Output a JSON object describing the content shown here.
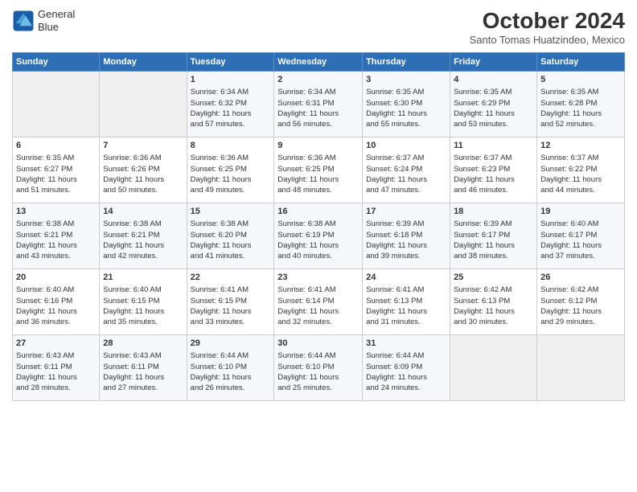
{
  "header": {
    "logo": {
      "line1": "General",
      "line2": "Blue"
    },
    "title": "October 2024",
    "subtitle": "Santo Tomas Huatzindeo, Mexico"
  },
  "days_of_week": [
    "Sunday",
    "Monday",
    "Tuesday",
    "Wednesday",
    "Thursday",
    "Friday",
    "Saturday"
  ],
  "weeks": [
    [
      {
        "day": "",
        "lines": []
      },
      {
        "day": "",
        "lines": []
      },
      {
        "day": "1",
        "lines": [
          "Sunrise: 6:34 AM",
          "Sunset: 6:32 PM",
          "Daylight: 11 hours",
          "and 57 minutes."
        ]
      },
      {
        "day": "2",
        "lines": [
          "Sunrise: 6:34 AM",
          "Sunset: 6:31 PM",
          "Daylight: 11 hours",
          "and 56 minutes."
        ]
      },
      {
        "day": "3",
        "lines": [
          "Sunrise: 6:35 AM",
          "Sunset: 6:30 PM",
          "Daylight: 11 hours",
          "and 55 minutes."
        ]
      },
      {
        "day": "4",
        "lines": [
          "Sunrise: 6:35 AM",
          "Sunset: 6:29 PM",
          "Daylight: 11 hours",
          "and 53 minutes."
        ]
      },
      {
        "day": "5",
        "lines": [
          "Sunrise: 6:35 AM",
          "Sunset: 6:28 PM",
          "Daylight: 11 hours",
          "and 52 minutes."
        ]
      }
    ],
    [
      {
        "day": "6",
        "lines": [
          "Sunrise: 6:35 AM",
          "Sunset: 6:27 PM",
          "Daylight: 11 hours",
          "and 51 minutes."
        ]
      },
      {
        "day": "7",
        "lines": [
          "Sunrise: 6:36 AM",
          "Sunset: 6:26 PM",
          "Daylight: 11 hours",
          "and 50 minutes."
        ]
      },
      {
        "day": "8",
        "lines": [
          "Sunrise: 6:36 AM",
          "Sunset: 6:25 PM",
          "Daylight: 11 hours",
          "and 49 minutes."
        ]
      },
      {
        "day": "9",
        "lines": [
          "Sunrise: 6:36 AM",
          "Sunset: 6:25 PM",
          "Daylight: 11 hours",
          "and 48 minutes."
        ]
      },
      {
        "day": "10",
        "lines": [
          "Sunrise: 6:37 AM",
          "Sunset: 6:24 PM",
          "Daylight: 11 hours",
          "and 47 minutes."
        ]
      },
      {
        "day": "11",
        "lines": [
          "Sunrise: 6:37 AM",
          "Sunset: 6:23 PM",
          "Daylight: 11 hours",
          "and 46 minutes."
        ]
      },
      {
        "day": "12",
        "lines": [
          "Sunrise: 6:37 AM",
          "Sunset: 6:22 PM",
          "Daylight: 11 hours",
          "and 44 minutes."
        ]
      }
    ],
    [
      {
        "day": "13",
        "lines": [
          "Sunrise: 6:38 AM",
          "Sunset: 6:21 PM",
          "Daylight: 11 hours",
          "and 43 minutes."
        ]
      },
      {
        "day": "14",
        "lines": [
          "Sunrise: 6:38 AM",
          "Sunset: 6:21 PM",
          "Daylight: 11 hours",
          "and 42 minutes."
        ]
      },
      {
        "day": "15",
        "lines": [
          "Sunrise: 6:38 AM",
          "Sunset: 6:20 PM",
          "Daylight: 11 hours",
          "and 41 minutes."
        ]
      },
      {
        "day": "16",
        "lines": [
          "Sunrise: 6:38 AM",
          "Sunset: 6:19 PM",
          "Daylight: 11 hours",
          "and 40 minutes."
        ]
      },
      {
        "day": "17",
        "lines": [
          "Sunrise: 6:39 AM",
          "Sunset: 6:18 PM",
          "Daylight: 11 hours",
          "and 39 minutes."
        ]
      },
      {
        "day": "18",
        "lines": [
          "Sunrise: 6:39 AM",
          "Sunset: 6:17 PM",
          "Daylight: 11 hours",
          "and 38 minutes."
        ]
      },
      {
        "day": "19",
        "lines": [
          "Sunrise: 6:40 AM",
          "Sunset: 6:17 PM",
          "Daylight: 11 hours",
          "and 37 minutes."
        ]
      }
    ],
    [
      {
        "day": "20",
        "lines": [
          "Sunrise: 6:40 AM",
          "Sunset: 6:16 PM",
          "Daylight: 11 hours",
          "and 36 minutes."
        ]
      },
      {
        "day": "21",
        "lines": [
          "Sunrise: 6:40 AM",
          "Sunset: 6:15 PM",
          "Daylight: 11 hours",
          "and 35 minutes."
        ]
      },
      {
        "day": "22",
        "lines": [
          "Sunrise: 6:41 AM",
          "Sunset: 6:15 PM",
          "Daylight: 11 hours",
          "and 33 minutes."
        ]
      },
      {
        "day": "23",
        "lines": [
          "Sunrise: 6:41 AM",
          "Sunset: 6:14 PM",
          "Daylight: 11 hours",
          "and 32 minutes."
        ]
      },
      {
        "day": "24",
        "lines": [
          "Sunrise: 6:41 AM",
          "Sunset: 6:13 PM",
          "Daylight: 11 hours",
          "and 31 minutes."
        ]
      },
      {
        "day": "25",
        "lines": [
          "Sunrise: 6:42 AM",
          "Sunset: 6:13 PM",
          "Daylight: 11 hours",
          "and 30 minutes."
        ]
      },
      {
        "day": "26",
        "lines": [
          "Sunrise: 6:42 AM",
          "Sunset: 6:12 PM",
          "Daylight: 11 hours",
          "and 29 minutes."
        ]
      }
    ],
    [
      {
        "day": "27",
        "lines": [
          "Sunrise: 6:43 AM",
          "Sunset: 6:11 PM",
          "Daylight: 11 hours",
          "and 28 minutes."
        ]
      },
      {
        "day": "28",
        "lines": [
          "Sunrise: 6:43 AM",
          "Sunset: 6:11 PM",
          "Daylight: 11 hours",
          "and 27 minutes."
        ]
      },
      {
        "day": "29",
        "lines": [
          "Sunrise: 6:44 AM",
          "Sunset: 6:10 PM",
          "Daylight: 11 hours",
          "and 26 minutes."
        ]
      },
      {
        "day": "30",
        "lines": [
          "Sunrise: 6:44 AM",
          "Sunset: 6:10 PM",
          "Daylight: 11 hours",
          "and 25 minutes."
        ]
      },
      {
        "day": "31",
        "lines": [
          "Sunrise: 6:44 AM",
          "Sunset: 6:09 PM",
          "Daylight: 11 hours",
          "and 24 minutes."
        ]
      },
      {
        "day": "",
        "lines": []
      },
      {
        "day": "",
        "lines": []
      }
    ]
  ]
}
